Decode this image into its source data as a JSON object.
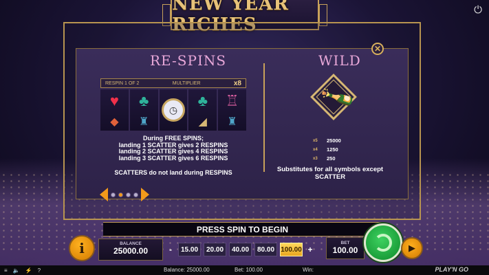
{
  "game": {
    "title": "NEW YEAR RICHES"
  },
  "respins": {
    "title": "RE-SPINS",
    "respin_label": "RESPIN 1 OF 2",
    "multiplier_label": "MULTIPLIER",
    "multiplier_value": "x8",
    "lines": [
      "During FREE SPINS;",
      "landing 1 SCATTER gives 2 RESPINS",
      "landing 2 SCATTER gives 4 RESPINS",
      "landing 3 SCATTER gives 6 RESPINS"
    ],
    "note": "SCATTERS do not land during RESPINS"
  },
  "wild": {
    "title": "WILD",
    "pays": [
      {
        "count": "x5",
        "value": "25000"
      },
      {
        "count": "x4",
        "value": "1250"
      },
      {
        "count": "x3",
        "value": "250"
      }
    ],
    "description": "Substitutes for all symbols except SCATTER"
  },
  "pager": {
    "pages": 4,
    "active": 1
  },
  "banner": {
    "text": "PRESS SPIN TO BEGIN"
  },
  "controls": {
    "balance_label": "BALANCE",
    "balance_value": "25000.00",
    "minus": "-",
    "plus": "+",
    "bet_options": [
      "15.00",
      "20.00",
      "40.00",
      "80.00",
      "100.00"
    ],
    "selected_bet": "100.00",
    "bet_label": "BET",
    "bet_value": "100.00",
    "info_label": "i"
  },
  "status": {
    "balance": "Balance: 25000.00",
    "bet": "Bet: 100.00",
    "win": "Win:",
    "brand": "PLAY'N GO",
    "help": "?"
  },
  "colors": {
    "accent_gold": "#c9a25a",
    "section_title": "#e7a7d8",
    "selected_bet": "#ffd95b",
    "spin_green": "#3dd160"
  }
}
